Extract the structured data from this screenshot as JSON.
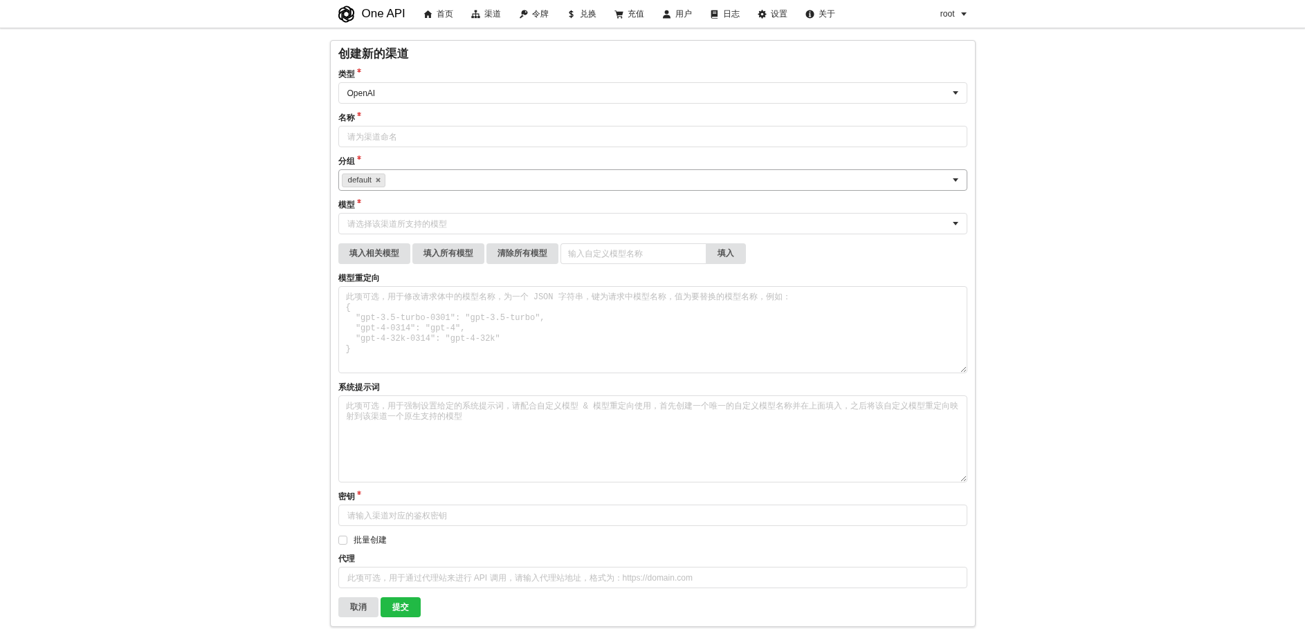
{
  "navbar": {
    "brand": "One API",
    "items": [
      {
        "label": "首页",
        "selected": false
      },
      {
        "label": "渠道",
        "selected": false
      },
      {
        "label": "令牌",
        "selected": false
      },
      {
        "label": "兑换",
        "selected": false
      },
      {
        "label": "充值",
        "selected": false
      },
      {
        "label": "用户",
        "selected": false
      },
      {
        "label": "日志",
        "selected": false
      },
      {
        "label": "设置",
        "selected": false
      },
      {
        "label": "关于",
        "selected": false
      }
    ],
    "user_menu": "root"
  },
  "form": {
    "title": "创建新的渠道",
    "fields": [
      {
        "kind": "select",
        "label": "类型",
        "required": true,
        "value": "OpenAI",
        "focused": false
      },
      {
        "kind": "input",
        "label": "名称",
        "required": true,
        "placeholder": "请为渠道命名",
        "focused": false
      },
      {
        "kind": "multiselect",
        "label": "分组",
        "required": true,
        "tags": [
          "default"
        ],
        "focused": true
      },
      {
        "kind": "select",
        "label": "模型",
        "required": true,
        "placeholder": "请选择该渠道所支持的模型",
        "focused": false
      },
      {
        "kind": "buttons",
        "buttons": [
          "填入相关模型",
          "填入所有模型",
          "清除所有模型"
        ],
        "custom_model": {
          "placeholder": "输入自定义模型名称",
          "button": "填入"
        }
      },
      {
        "kind": "textarea",
        "label": "模型重定向",
        "required": false,
        "placeholder": "此项可选，用于修改请求体中的模型名称，为一个 JSON 字符串，键为请求中模型名称，值为要替换的模型名称，例如：\n{\n  \"gpt-3.5-turbo-0301\": \"gpt-3.5-turbo\",\n  \"gpt-4-0314\": \"gpt-4\",\n  \"gpt-4-32k-0314\": \"gpt-4-32k\"\n}",
        "focused": false
      },
      {
        "kind": "textarea",
        "label": "系统提示词",
        "required": false,
        "placeholder": "此项可选，用于强制设置给定的系统提示词，请配合自定义模型 & 模型重定向使用，首先创建一个唯一的自定义模型名称并在上面填入，之后将该自定义模型重定向映射到该渠道一个原生支持的模型",
        "focused": false
      },
      {
        "kind": "input",
        "label": "密钥",
        "required": true,
        "placeholder": "请输入渠道对应的鉴权密钥",
        "focused": false
      },
      {
        "kind": "checkbox",
        "label": "批量创建",
        "checked": false
      },
      {
        "kind": "input",
        "label": "代理",
        "required": false,
        "placeholder": "此项可选，用于通过代理站来进行 API 调用，请输入代理站地址，格式为：https://domain.com",
        "focused": false
      }
    ],
    "actions": [
      {
        "label": "取消",
        "kind": "secondary"
      },
      {
        "label": "提交",
        "kind": "primary"
      }
    ]
  }
}
